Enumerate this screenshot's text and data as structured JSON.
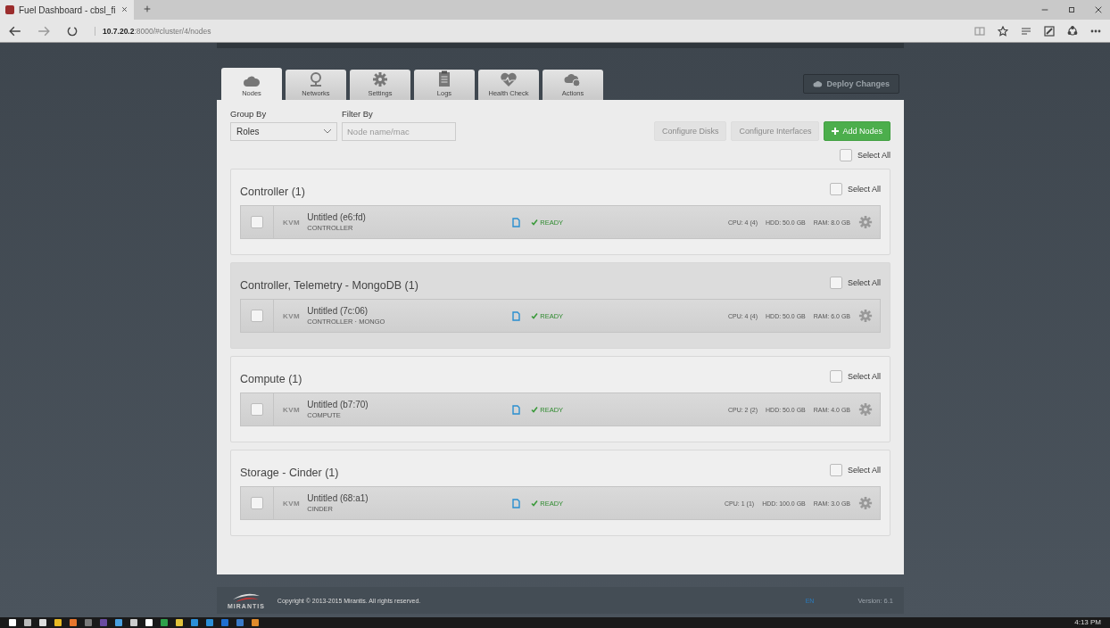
{
  "browser": {
    "tab_title": "Fuel Dashboard - cbsl_fi",
    "url_host": "10.7.20.2",
    "url_rest": ":8000/#cluster/4/nodes"
  },
  "tabs": [
    {
      "label": "Nodes",
      "selected": true
    },
    {
      "label": "Networks",
      "selected": false
    },
    {
      "label": "Settings",
      "selected": false
    },
    {
      "label": "Logs",
      "selected": false
    },
    {
      "label": "Health Check",
      "selected": false
    },
    {
      "label": "Actions",
      "selected": false
    }
  ],
  "deploy_button": "Deploy Changes",
  "group_by": {
    "label": "Group By",
    "value": "Roles"
  },
  "filter_by": {
    "label": "Filter By",
    "placeholder": "Node name/mac"
  },
  "buttons": [
    {
      "label": "Configure Disks",
      "disabled": true
    },
    {
      "label": "Configure Interfaces",
      "disabled": true
    },
    {
      "label": "Add Nodes",
      "disabled": false
    }
  ],
  "select_all": {
    "label": "Select All",
    "checked": false
  },
  "groups": [
    {
      "title": "Controller (1)",
      "highlighted": false,
      "select_all": {
        "label": "Select All",
        "checked": false
      },
      "nodes": [
        {
          "checked": false,
          "type": "KVM",
          "name": "Untitled (e6:fd)",
          "roles": "CONTROLLER",
          "status": "READY",
          "cpu": "CPU: 4 (4)",
          "hdd": "HDD: 50.0 GB",
          "ram": "RAM: 8.0 GB"
        }
      ]
    },
    {
      "title": "Controller, Telemetry - MongoDB (1)",
      "highlighted": true,
      "select_all": {
        "label": "Select All",
        "checked": false
      },
      "nodes": [
        {
          "checked": false,
          "type": "KVM",
          "name": "Untitled (7c:06)",
          "roles": "CONTROLLER · MONGO",
          "status": "READY",
          "cpu": "CPU: 4 (4)",
          "hdd": "HDD: 50.0 GB",
          "ram": "RAM: 6.0 GB"
        }
      ]
    },
    {
      "title": "Compute (1)",
      "highlighted": false,
      "select_all": {
        "label": "Select All",
        "checked": false
      },
      "nodes": [
        {
          "checked": false,
          "type": "KVM",
          "name": "Untitled (b7:70)",
          "roles": "COMPUTE",
          "status": "READY",
          "cpu": "CPU: 2 (2)",
          "hdd": "HDD: 50.0 GB",
          "ram": "RAM: 4.0 GB"
        }
      ]
    },
    {
      "title": "Storage - Cinder (1)",
      "highlighted": false,
      "select_all": {
        "label": "Select All",
        "checked": false
      },
      "nodes": [
        {
          "checked": false,
          "type": "KVM",
          "name": "Untitled (68:a1)",
          "roles": "CINDER",
          "status": "READY",
          "cpu": "CPU: 1 (1)",
          "hdd": "HDD: 100.0 GB",
          "ram": "RAM: 3.0 GB"
        }
      ]
    }
  ],
  "footer": {
    "logo_text": "MIRANTIS",
    "copyright": "Copyright © 2013-2015 Mirantis. All rights reserved.",
    "language": "EN",
    "version": "Version: 6.1"
  },
  "taskbar": {
    "time": "4:13 PM"
  }
}
